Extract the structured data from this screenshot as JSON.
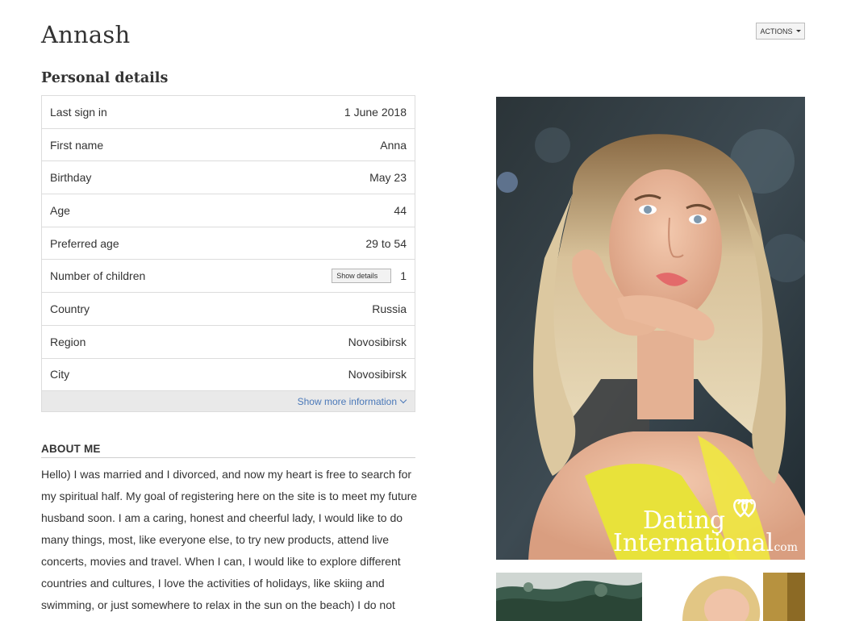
{
  "profile": {
    "name": "Annash"
  },
  "actions": {
    "label": "ACTIONS"
  },
  "personal_details": {
    "title": "Personal details",
    "rows": [
      {
        "label": "Last sign in",
        "value": "1 June 2018"
      },
      {
        "label": "First name",
        "value": "Anna"
      },
      {
        "label": "Birthday",
        "value": "May 23"
      },
      {
        "label": "Age",
        "value": "44"
      },
      {
        "label": "Preferred age",
        "value": "29 to 54"
      },
      {
        "label": "Number of children",
        "value": "1",
        "button": "Show details"
      },
      {
        "label": "Country",
        "value": "Russia"
      },
      {
        "label": "Region",
        "value": "Novosibirsk"
      },
      {
        "label": "City",
        "value": "Novosibirsk"
      }
    ],
    "show_more": "Show more information"
  },
  "about": {
    "heading": "ABOUT ME",
    "text": "Hello) I was married and I divorced, and now my heart is free to search for my spiritual half. My goal of registering here on the site is to meet my future husband soon. I am a caring, honest and cheerful lady, I would like to do many things, most, like everyone else, to try new products, attend live concerts, movies and travel. When I can, I would like to explore different countries and cultures, I love the activities of holidays, like skiing and swimming, or just somewhere to relax in the sun on the beach) I do not know"
  },
  "photo": {
    "watermark_line1": "Dating",
    "watermark_line2": "International",
    "watermark_suffix": ".com"
  },
  "colors": {
    "link": "#4a78b8",
    "border": "#dcdcdc",
    "footer_bg": "#e9e9e9"
  }
}
